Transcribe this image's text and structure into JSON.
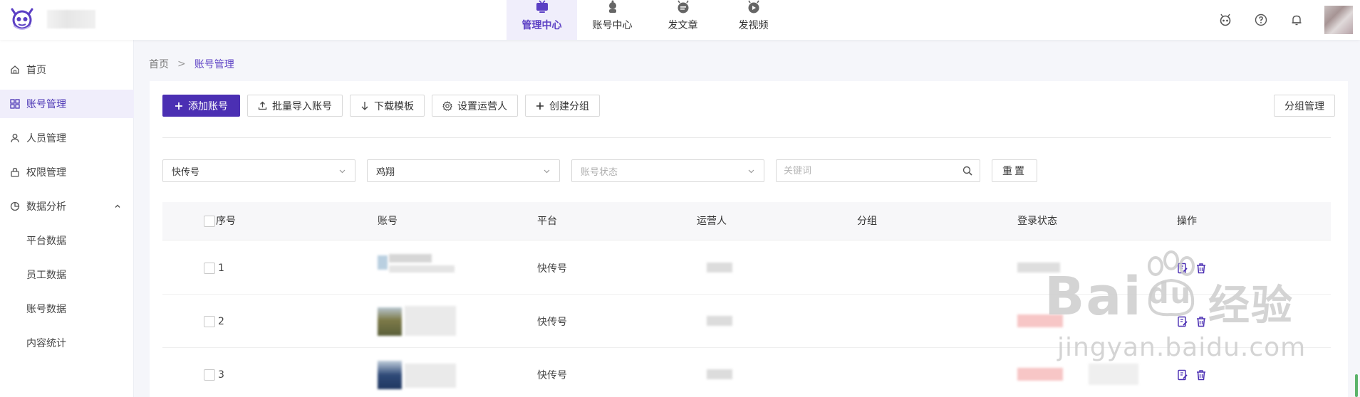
{
  "colors": {
    "accent": "#4b2fb3",
    "active_bg": "#f0eefb",
    "active_text": "#5b3fc4"
  },
  "topnav": [
    {
      "label": "管理中心",
      "icon": "tv-icon",
      "active": true
    },
    {
      "label": "账号中心",
      "icon": "robot-icon",
      "active": false
    },
    {
      "label": "发文章",
      "icon": "article-icon",
      "active": false
    },
    {
      "label": "发视频",
      "icon": "video-icon",
      "active": false
    }
  ],
  "top_icons": [
    "bot-icon",
    "help-icon",
    "bell-icon"
  ],
  "sidebar": {
    "items": [
      {
        "label": "首页",
        "icon": "home-icon"
      },
      {
        "label": "账号管理",
        "icon": "grid-icon"
      },
      {
        "label": "人员管理",
        "icon": "user-icon"
      },
      {
        "label": "权限管理",
        "icon": "lock-icon"
      },
      {
        "label": "数据分析",
        "icon": "chart-icon"
      }
    ],
    "sub_items": [
      "平台数据",
      "员工数据",
      "账号数据",
      "内容统计"
    ]
  },
  "breadcrumb": {
    "home": "首页",
    "sep": ">",
    "current": "账号管理"
  },
  "toolbar": {
    "add": "添加账号",
    "batch_import": "批量导入账号",
    "download": "下载模板",
    "set_operator": "设置运营人",
    "create_group": "创建分组",
    "group_manage": "分组管理"
  },
  "filters": {
    "platform": "快传号",
    "account": "鸡翔",
    "status_placeholder": "账号状态",
    "keyword_placeholder": "关键词",
    "reset": "重置"
  },
  "table": {
    "columns": [
      "序号",
      "账号",
      "平台",
      "运营人",
      "分组",
      "登录状态",
      "操作"
    ],
    "rows": [
      {
        "index": "1",
        "platform": "快传号"
      },
      {
        "index": "2",
        "platform": "快传号"
      },
      {
        "index": "3",
        "platform": "快传号"
      }
    ]
  },
  "watermark": {
    "brand": "Bai",
    "paw": "du",
    "suffix": "经验",
    "url": "jingyan.baidu.com"
  }
}
